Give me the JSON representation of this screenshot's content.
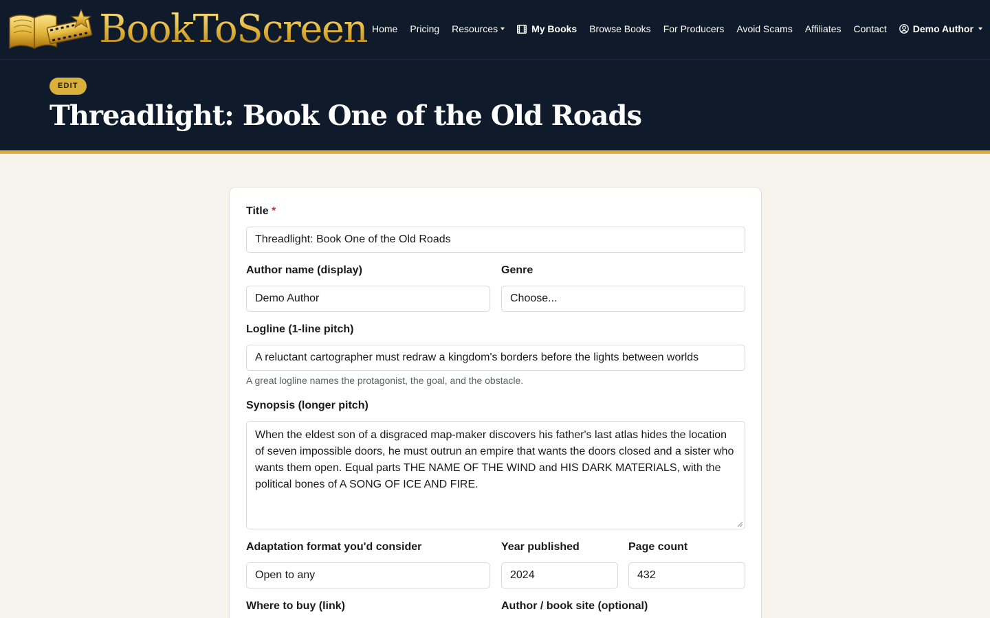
{
  "brand": {
    "name": "BookToScreen"
  },
  "nav": {
    "home": "Home",
    "pricing": "Pricing",
    "resources": "Resources",
    "my_books": "My Books",
    "browse_books": "Browse Books",
    "for_producers": "For Producers",
    "avoid_scams": "Avoid Scams",
    "affiliates": "Affiliates",
    "contact": "Contact",
    "user": "Demo Author"
  },
  "hero": {
    "badge": "EDIT",
    "title": "Threadlight: Book One of the Old Roads"
  },
  "form": {
    "title_label": "Title",
    "title_required": "*",
    "title_value": "Threadlight: Book One of the Old Roads",
    "author_label": "Author name (display)",
    "author_value": "Demo Author",
    "genre_label": "Genre",
    "genre_value": "Choose...",
    "logline_label": "Logline (1-line pitch)",
    "logline_value": "A reluctant cartographer must redraw a kingdom's borders before the lights between worlds",
    "logline_hint": "A great logline names the protagonist, the goal, and the obstacle.",
    "synopsis_label": "Synopsis (longer pitch)",
    "synopsis_value": "When the eldest son of a disgraced map-maker discovers his father's last atlas hides the location of seven impossible doors, he must outrun an empire that wants the doors closed and a sister who wants them open. Equal parts THE NAME OF THE WIND and HIS DARK MATERIALS, with the political bones of A SONG OF ICE AND FIRE.",
    "format_label": "Adaptation format you'd consider",
    "format_value": "Open to any",
    "year_label": "Year published",
    "year_value": "2024",
    "pages_label": "Page count",
    "pages_value": "432",
    "buy_label": "Where to buy (link)",
    "site_label": "Author / book site (optional)"
  },
  "colors": {
    "navy": "#0f1b2b",
    "gold": "#d9b03c",
    "page_bg": "#f6f3ec",
    "required": "#d63031"
  },
  "icons": [
    "books-logo-icon",
    "film-icon",
    "user-circle-icon",
    "caret-down-icon"
  ]
}
